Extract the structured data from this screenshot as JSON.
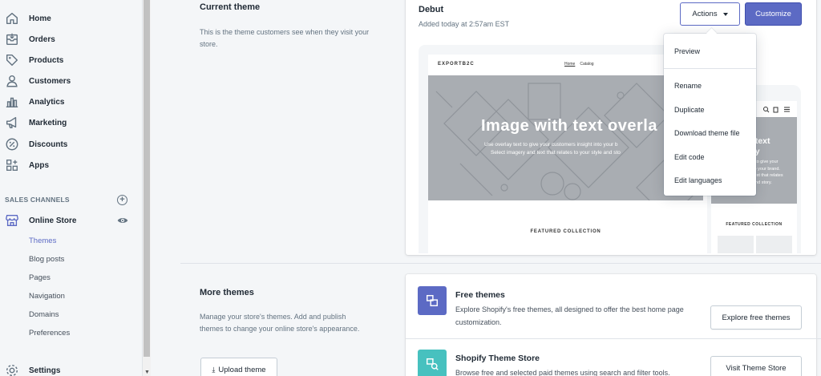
{
  "sidebar": {
    "items": [
      {
        "label": "Home",
        "icon": "home-icon"
      },
      {
        "label": "Orders",
        "icon": "orders-icon"
      },
      {
        "label": "Products",
        "icon": "tag-icon"
      },
      {
        "label": "Customers",
        "icon": "person-icon"
      },
      {
        "label": "Analytics",
        "icon": "bar-chart-icon"
      },
      {
        "label": "Marketing",
        "icon": "megaphone-icon"
      },
      {
        "label": "Discounts",
        "icon": "discount-icon"
      },
      {
        "label": "Apps",
        "icon": "apps-icon"
      }
    ],
    "channels_header": "SALES CHANNELS",
    "online_store": "Online Store",
    "sub_items": [
      "Themes",
      "Blog posts",
      "Pages",
      "Navigation",
      "Domains",
      "Preferences"
    ],
    "settings": "Settings"
  },
  "current_theme": {
    "section_title": "Current theme",
    "section_desc": "This is the theme customers see when they visit your store.",
    "name": "Debut",
    "added": "Added today at 2:57am EST",
    "actions_label": "Actions",
    "customize_label": "Customize",
    "preview": {
      "store_name": "EXPORTB2C",
      "nav": [
        "Home",
        "Catalog"
      ],
      "hero_title": "Image with text overla",
      "hero_sub_1": "Use overlay text to give your customers insight into your b",
      "hero_sub_2": "Select imagery and text that relates to your style and sto",
      "featured": "FEATURED COLLECTION",
      "mobile_title_1": "th text",
      "mobile_title_2": "lay",
      "mobile_sub": [
        "t to give your",
        "to your brand.",
        "text that relates",
        "and story."
      ],
      "mobile_featured": "FEATURED COLLECTION"
    }
  },
  "actions_menu": {
    "items": [
      "Preview",
      "Rename",
      "Duplicate",
      "Download theme file",
      "Edit code",
      "Edit languages"
    ]
  },
  "more_themes": {
    "section_title": "More themes",
    "section_desc": "Manage your store's themes. Add and publish themes to change your online store's appearance.",
    "upload_label": "Upload theme",
    "free": {
      "title": "Free themes",
      "desc": "Explore Shopify's free themes, all designed to offer the best home page customization.",
      "button": "Explore free themes",
      "color": "#5c6ac4"
    },
    "store": {
      "title": "Shopify Theme Store",
      "desc": "Browse free and selected paid themes using search and filter tools.",
      "button": "Visit Theme Store",
      "color": "#47c1bf"
    }
  },
  "colors": {
    "accent": "#5c6ac4",
    "teal": "#47c1bf"
  }
}
